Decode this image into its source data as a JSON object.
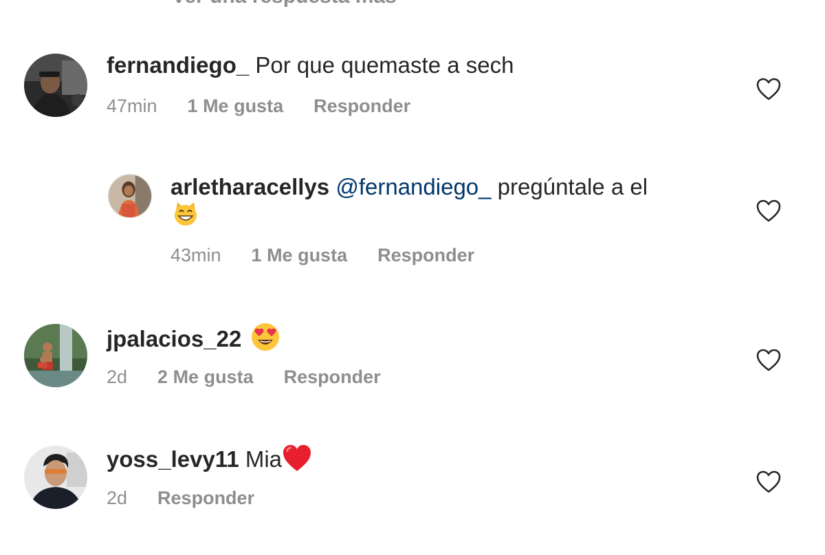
{
  "top_partial_text": "Ver una respuesta más",
  "comments": [
    {
      "username": "fernandiego_",
      "text": " Por que quemaste a sech",
      "time": "47min",
      "likes": "1 Me gusta",
      "reply": "Responder"
    },
    {
      "username": "arletharacellys",
      "mention": "@fernandiego_",
      "text": " pregúntale a el",
      "emoji": "grinning-cat-emoji",
      "time": "43min",
      "likes": "1 Me gusta",
      "reply": "Responder"
    },
    {
      "username": "jpalacios_22",
      "text": " ",
      "emoji": "heart-eyes-emoji",
      "time": "2d",
      "likes": "2 Me gusta",
      "reply": "Responder"
    },
    {
      "username": "yoss_levy11",
      "text": " Mia",
      "emoji": "red-heart-emoji",
      "time": "2d",
      "reply": "Responder"
    }
  ],
  "colors": {
    "text": "#262626",
    "secondary": "#8e8e8e",
    "mention": "#00376b",
    "background": "#ffffff"
  }
}
